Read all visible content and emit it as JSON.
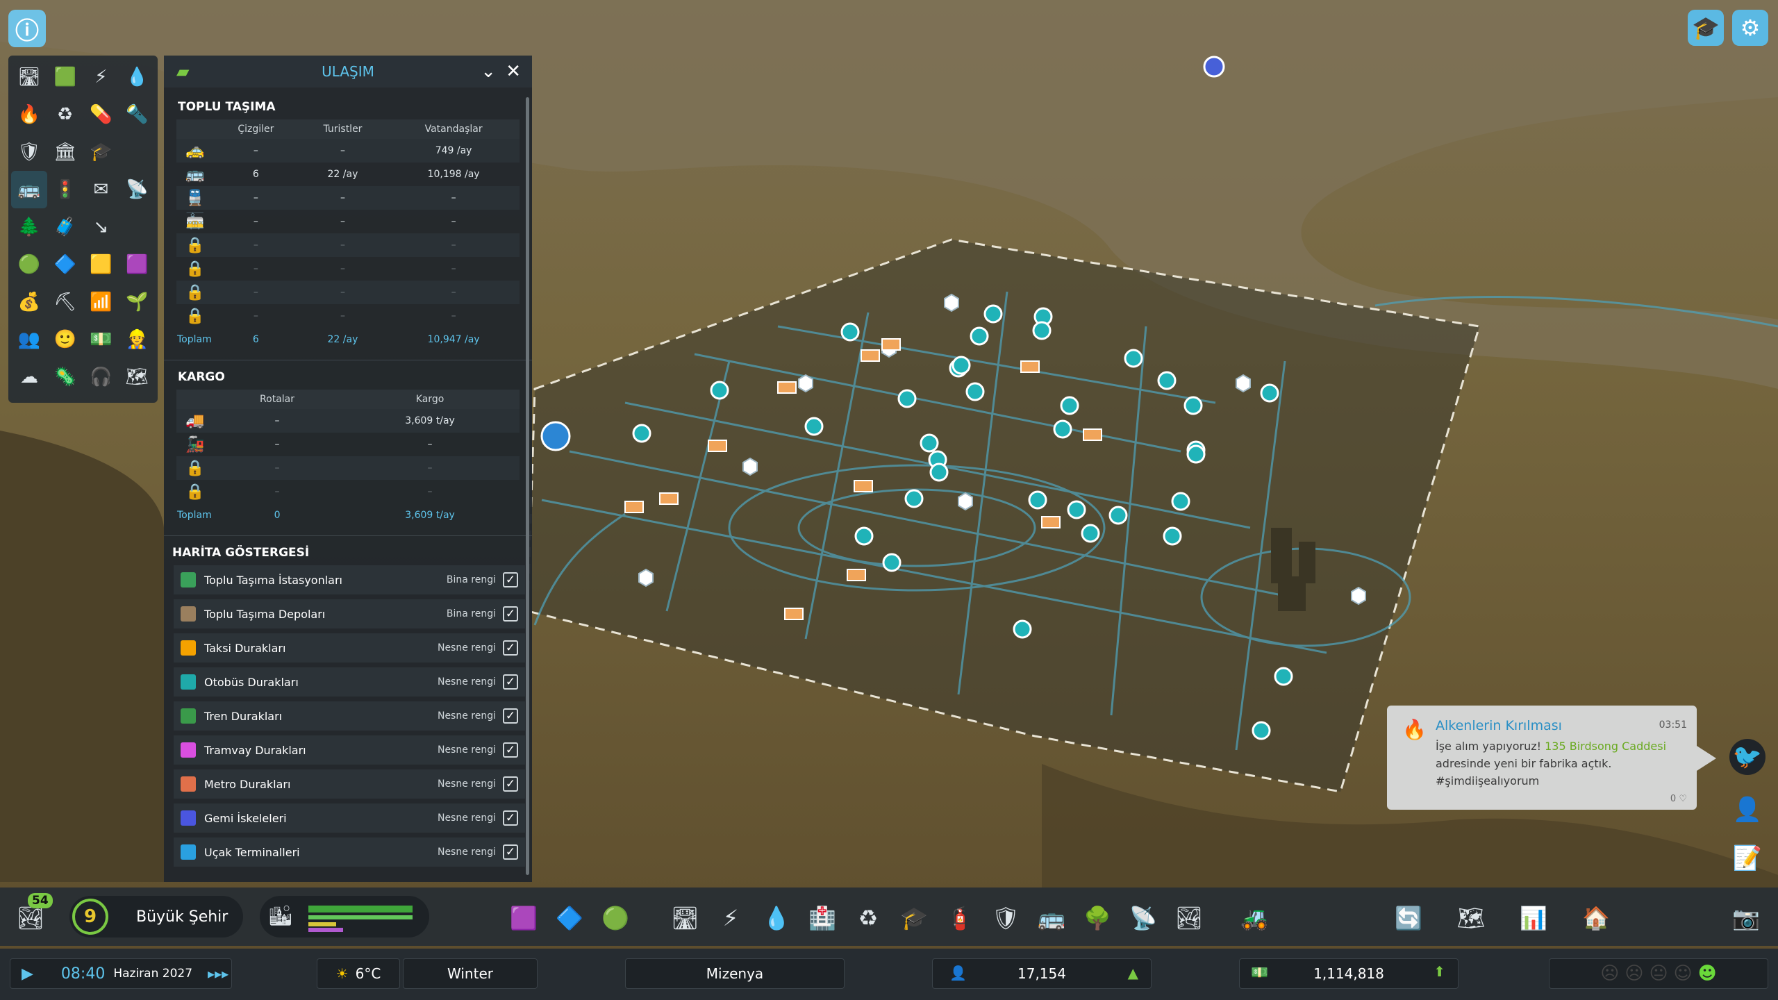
{
  "panel": {
    "title": "ULAŞIM",
    "public_transport": {
      "heading": "TOPLU TAŞIMA",
      "columns": [
        "Çizgiler",
        "Turistler",
        "Vatandaşlar"
      ],
      "rows": [
        {
          "icon": "taxi-icon",
          "lines": "–",
          "tourists": "–",
          "citizens": "749 /ay",
          "locked": false
        },
        {
          "icon": "bus-icon",
          "lines": "6",
          "tourists": "22 /ay",
          "citizens": "10,198 /ay",
          "locked": false
        },
        {
          "icon": "train-icon",
          "lines": "–",
          "tourists": "–",
          "citizens": "–",
          "locked": false
        },
        {
          "icon": "tram-icon",
          "lines": "–",
          "tourists": "–",
          "citizens": "–",
          "locked": false
        },
        {
          "icon": "subway-locked-icon",
          "lines": "–",
          "tourists": "–",
          "citizens": "–",
          "locked": true
        },
        {
          "icon": "ship-locked-icon",
          "lines": "–",
          "tourists": "–",
          "citizens": "–",
          "locked": true
        },
        {
          "icon": "airplane-locked-icon",
          "lines": "–",
          "tourists": "–",
          "citizens": "–",
          "locked": true
        },
        {
          "icon": "ferry-locked-icon",
          "lines": "–",
          "tourists": "–",
          "citizens": "–",
          "locked": true
        }
      ],
      "total": {
        "label": "Toplam",
        "lines": "6",
        "tourists": "22 /ay",
        "citizens": "10,947 /ay"
      }
    },
    "cargo": {
      "heading": "KARGO",
      "columns": [
        "Rotalar",
        "Kargo"
      ],
      "rows": [
        {
          "icon": "cargo-truck-icon",
          "routes": "–",
          "cargo": "3,609 t/ay",
          "locked": false
        },
        {
          "icon": "cargo-train-icon",
          "routes": "–",
          "cargo": "–",
          "locked": false
        },
        {
          "icon": "cargo-ship-locked-icon",
          "routes": "–",
          "cargo": "–",
          "locked": true
        },
        {
          "icon": "cargo-plane-locked-icon",
          "routes": "–",
          "cargo": "–",
          "locked": true
        }
      ],
      "total": {
        "label": "Toplam",
        "routes": "0",
        "cargo": "3,609 t/ay"
      }
    },
    "legend": {
      "heading": "HARİTA GÖSTERGESİ",
      "items": [
        {
          "label": "Toplu Taşıma İstasyonları",
          "mode": "Bina rengi",
          "color": "#3aa05a"
        },
        {
          "label": "Toplu Taşıma Depoları",
          "mode": "Bina rengi",
          "color": "#9a7f5e"
        },
        {
          "label": "Taksi Durakları",
          "mode": "Nesne rengi",
          "color": "#f5a200"
        },
        {
          "label": "Otobüs Durakları",
          "mode": "Nesne rengi",
          "color": "#1fa9a9"
        },
        {
          "label": "Tren Durakları",
          "mode": "Nesne rengi",
          "color": "#3a9a4a"
        },
        {
          "label": "Tramvay Durakları",
          "mode": "Nesne rengi",
          "color": "#d94fe0"
        },
        {
          "label": "Metro Durakları",
          "mode": "Nesne rengi",
          "color": "#e0704a"
        },
        {
          "label": "Gemi İskeleleri",
          "mode": "Nesne rengi",
          "color": "#4a56e0"
        },
        {
          "label": "Uçak Terminalleri",
          "mode": "Nesne rengi",
          "color": "#2aa0e0"
        }
      ]
    }
  },
  "notification": {
    "title": "Alkenlerin Kırılması",
    "time": "03:51",
    "body_prefix": "İşe alım yapıyoruz!",
    "link": "135 Birdsong Caddesi",
    "body_suffix": "adresinde yeni bir fabrika açtık. #şimdiişealıyorum",
    "likes": "0"
  },
  "toolbar": {
    "badge": "54",
    "level": "9",
    "city_rank": "Büyük Şehir"
  },
  "status": {
    "time": "08:40",
    "date": "Haziran 2027",
    "temperature": "6°C",
    "season": "Winter",
    "city_name": "Mizenya",
    "population": "17,154",
    "money": "1,114,818"
  }
}
